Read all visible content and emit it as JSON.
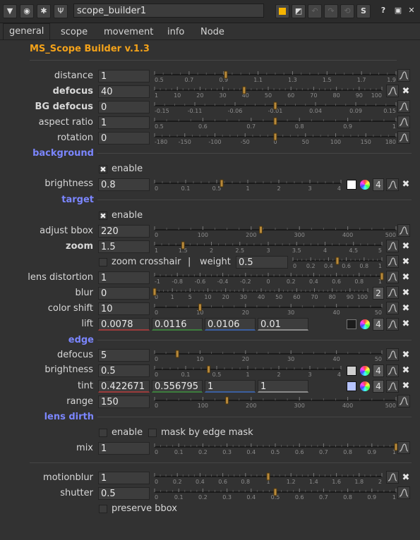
{
  "window": {
    "node_name": "scope_builder1",
    "tabs": [
      "general",
      "scope",
      "movement",
      "info",
      "Node"
    ],
    "active_tab": "general",
    "toolbar_s_label": "S",
    "toolbar_help_label": "?"
  },
  "panel_title": "MS_Scope Builder v.1.3",
  "colors": {
    "section": "#7b86ff",
    "title": "#f3a21a",
    "lift_swatch": "#1c1c1c",
    "brightness_bg_swatch": "#ffffff",
    "edge_brightness_swatch": "#cfcfcf",
    "tint_swatch": "#b7c4ff"
  },
  "params": {
    "distance": {
      "label": "distance",
      "value": "1",
      "ticks": [
        "0.5",
        "0.7",
        "0.9",
        "1.1",
        "1.3",
        "1.5",
        "1.7",
        "1.9"
      ],
      "slider": 0.295
    },
    "defocus": {
      "label": "defocus",
      "value": "40",
      "ticks": [
        "1",
        "10",
        "20",
        "30",
        "40",
        "50",
        "60",
        "70",
        "80",
        "90",
        "100"
      ],
      "slider": 0.394
    },
    "bg_defocus": {
      "label": "BG defocus",
      "value": "0",
      "ticks": [
        "-0.15",
        "-0.11",
        "-0.06",
        "-0.01",
        "0.04",
        "0.09",
        "0.15"
      ],
      "slider": 0.5
    },
    "aspect_ratio": {
      "label": "aspect ratio",
      "value": "1",
      "ticks": [
        "0.5",
        "0.6",
        "0.7",
        "0.8",
        "0.9",
        "1"
      ],
      "slider": 0.5
    },
    "rotation": {
      "label": "rotation",
      "value": "0",
      "ticks": [
        "-180",
        "-150",
        "-100",
        "-50",
        "0",
        "50",
        "100",
        "150",
        "180"
      ],
      "slider": 0.5
    }
  },
  "background": {
    "section": "background",
    "enable_label": "enable",
    "enable_checked": true,
    "brightness": {
      "label": "brightness",
      "value": "0.8",
      "ticks": [
        "0",
        "0.1",
        "0.5",
        "1",
        "2",
        "3",
        "4"
      ],
      "slider": 0.36,
      "channels": "4"
    }
  },
  "target": {
    "section": "target",
    "enable_label": "enable",
    "enable_checked": true,
    "adjust_bbox": {
      "label": "adjust bbox",
      "value": "220",
      "ticks": [
        "0",
        "100",
        "200",
        "300",
        "400",
        "500"
      ],
      "slider": 0.44
    },
    "zoom": {
      "label": "zoom",
      "value": "1.5",
      "ticks": [
        "1",
        "1.5",
        "2",
        "2.5",
        "3",
        "3.5",
        "4",
        "4.5",
        "5"
      ],
      "slider": 0.125
    },
    "zoom_crosshair_label": "zoom crosshair",
    "zoom_crosshair_checked": false,
    "divider": "|",
    "weight": {
      "label": "weight",
      "value": "0.5",
      "ticks": [
        "0",
        "0.2",
        "0.4",
        "0.6",
        "0.8",
        "1"
      ],
      "slider": 0.5
    },
    "lens_distortion": {
      "label": "lens distortion",
      "value": "1",
      "ticks": [
        "-1",
        "-0.8",
        "-0.6",
        "-0.4",
        "-0.2",
        "0",
        "0.2",
        "0.4",
        "0.6",
        "0.8",
        "1"
      ],
      "slider": 1.0
    },
    "blur": {
      "label": "blur",
      "value": "0",
      "ticks": [
        "0",
        "1",
        "5",
        "10",
        "20",
        "30",
        "40",
        "50",
        "60",
        "70",
        "80",
        "90",
        "100"
      ],
      "slider": 0.0,
      "channels": "2"
    },
    "color_shift": {
      "label": "color shift",
      "value": "10",
      "ticks": [
        "0",
        "10",
        "20",
        "30",
        "40",
        "50"
      ],
      "slider": 0.2
    },
    "lift": {
      "label": "lift",
      "values": [
        "0.0078",
        "0.0116",
        "0.0106",
        "0.01"
      ],
      "channels": "4"
    }
  },
  "edge": {
    "section": "edge",
    "defocus": {
      "label": "defocus",
      "value": "5",
      "ticks": [
        "0",
        "10",
        "20",
        "30",
        "40",
        "50"
      ],
      "slider": 0.1
    },
    "brightness": {
      "label": "brightness",
      "value": "0.5",
      "ticks": [
        "0",
        "0.1",
        "0.5",
        "1",
        "2",
        "3",
        "4"
      ],
      "slider": 0.29,
      "channels": "4"
    },
    "tint": {
      "label": "tint",
      "values": [
        "0.422671",
        "0.556795",
        "1",
        "1"
      ],
      "channels": "4"
    },
    "range": {
      "label": "range",
      "value": "150",
      "ticks": [
        "0",
        "100",
        "200",
        "300",
        "400",
        "500"
      ],
      "slider": 0.3
    }
  },
  "lens_dirth": {
    "section": "lens dirth",
    "enable_label": "enable",
    "enable_checked": false,
    "mask_label": "mask by edge mask",
    "mask_checked": false,
    "mix": {
      "label": "mix",
      "value": "1",
      "ticks": [
        "0",
        "0.1",
        "0.2",
        "0.3",
        "0.4",
        "0.5",
        "0.6",
        "0.7",
        "0.8",
        "0.9",
        "1"
      ],
      "slider": 1.0
    }
  },
  "motion": {
    "motionblur": {
      "label": "motionblur",
      "value": "1",
      "ticks": [
        "0",
        "0.2",
        "0.4",
        "0.6",
        "0.8",
        "1",
        "1.2",
        "1.4",
        "1.6",
        "1.8",
        "2"
      ],
      "slider": 0.5
    },
    "shutter": {
      "label": "shutter",
      "value": "0.5",
      "ticks": [
        "0",
        "0.1",
        "0.2",
        "0.3",
        "0.4",
        "0.5",
        "0.6",
        "0.7",
        "0.8",
        "0.9",
        "1"
      ],
      "slider": 0.5
    },
    "preserve_bbox_label": "preserve bbox",
    "preserve_bbox_checked": false
  }
}
